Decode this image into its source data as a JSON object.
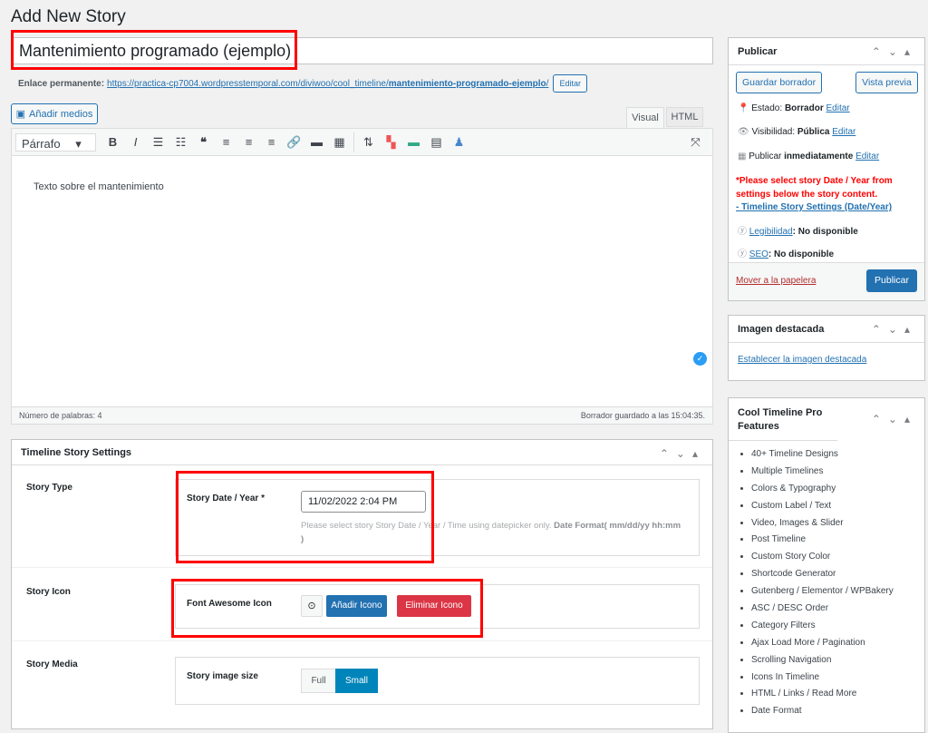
{
  "page_title": "Add New Story",
  "post_title": "Mantenimiento programado (ejemplo)",
  "permalink": {
    "label": "Enlace permanente:",
    "url_base": "https://practica-cp7004.wordpresstemporal.com/diviwoo/cool_timeline/",
    "slug": "mantenimiento-programado-ejemplo",
    "slash": "/",
    "edit": "Editar"
  },
  "editor": {
    "add_media": "Añadir medios",
    "tabs": [
      "Visual",
      "HTML"
    ],
    "format_select": "Párrafo",
    "content": "Texto sobre el mantenimiento",
    "word_count": "Número de palabras: 4",
    "saved": "Borrador guardado a las 15:04:35."
  },
  "settings": {
    "title": "Timeline Story Settings",
    "story_type": "Story Type",
    "date_label": "Story Date / Year *",
    "date_value": "11/02/2022 2:04 PM",
    "date_help": "Please select story Story Date / Year / Time using datepicker only.",
    "date_format": "Date Format( mm/dd/yy hh:mm )",
    "story_icon": "Story Icon",
    "fa_label": "Font Awesome Icon",
    "add_icon": "Añadir Icono",
    "remove_icon": "Eliminar Icono",
    "story_media": "Story Media",
    "image_size_label": "Story image size",
    "size_options": [
      "Full",
      "Small"
    ],
    "size_selected": "Small"
  },
  "publish": {
    "title": "Publicar",
    "save_draft": "Guardar borrador",
    "preview": "Vista previa",
    "status_label": "Estado:",
    "status": "Borrador",
    "visibility_label": "Visibilidad:",
    "visibility": "Pública",
    "publish_label": "Publicar",
    "publish_when": "inmediatamente",
    "edit": "Editar",
    "warning": "*Please select story Date / Year from settings below the story content.",
    "warning_link": "- Timeline Story Settings (Date/Year)",
    "readability": "Legibilidad",
    "seo": "SEO",
    "not_available": ": No disponible",
    "trash": "Mover a la papelera",
    "publish_btn": "Publicar"
  },
  "featured": {
    "title": "Imagen destacada",
    "set": "Establecer la imagen destacada"
  },
  "features": {
    "title": "Cool Timeline Pro Features",
    "items": [
      "40+ Timeline Designs",
      "Multiple Timelines",
      "Colors & Typography",
      "Custom Label / Text",
      "Video, Images & Slider",
      "Post Timeline",
      "Custom Story Color",
      "Shortcode Generator",
      "Gutenberg / Elementor / WPBakery",
      "ASC / DESC Order",
      "Category Filters",
      "Ajax Load More / Pagination",
      "Scrolling Navigation",
      "Icons In Timeline",
      "HTML / Links / Read More",
      "Date Format"
    ]
  },
  "colors": {
    "primary": "#2271b1",
    "danger": "#dc3545",
    "selected": "#0085ba",
    "highlight": "#ff0000"
  }
}
